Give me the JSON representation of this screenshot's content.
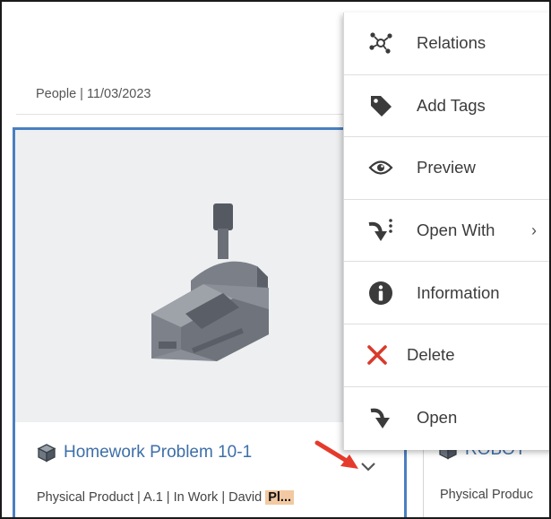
{
  "top_card": {
    "meta": "People | 11/03/2023"
  },
  "selected_card": {
    "title": "Homework Problem 10-1",
    "details_prefix": "Physical Product | A.1 | In Work | David ",
    "details_highlight": "Pl...",
    "thumbnail": "v-block-clamp-model"
  },
  "right_card": {
    "title": "ROBOT",
    "details": "Physical Produc"
  },
  "context_menu": {
    "items": [
      {
        "label": "Relations",
        "icon": "relations-icon"
      },
      {
        "label": "Add Tags",
        "icon": "tag-icon"
      },
      {
        "label": "Preview",
        "icon": "eye-icon"
      },
      {
        "label": "Open With",
        "icon": "open-with-icon",
        "submenu": true
      },
      {
        "label": "Information",
        "icon": "info-icon"
      },
      {
        "label": "Delete",
        "icon": "delete-icon"
      },
      {
        "label": "Open",
        "icon": "open-icon"
      }
    ],
    "submenu_glyph": "›"
  },
  "colors": {
    "accent_blue": "#4a7fc0",
    "title_blue": "#3d6fa8",
    "delete_red": "#d93a2b",
    "highlight": "#f2c9a2",
    "annotation_arrow": "#e53b2c"
  }
}
